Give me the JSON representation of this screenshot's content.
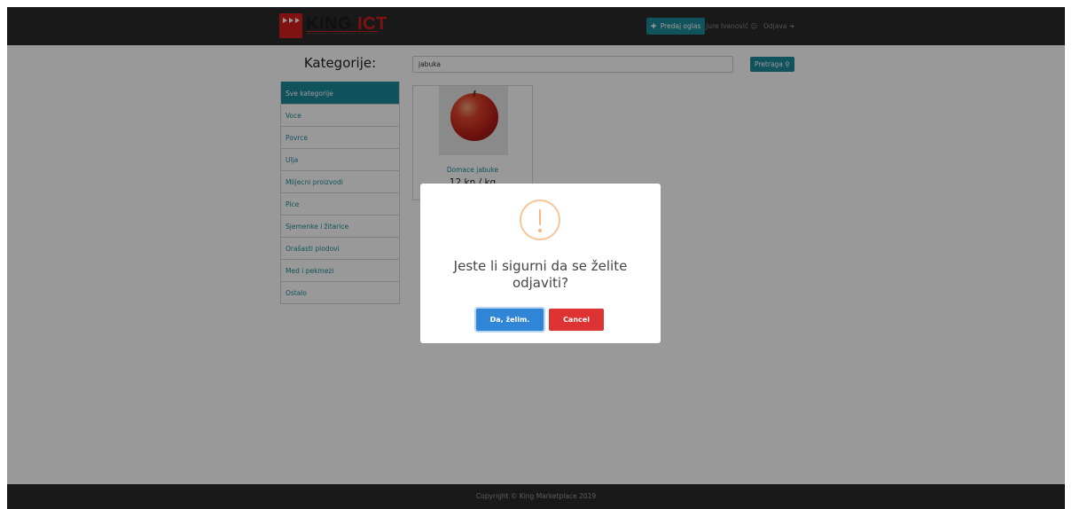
{
  "navbar": {
    "logo": {
      "brand_primary": "KING",
      "brand_secondary": "ICT",
      "tagline": "INFORMATION & COMMUNICATION TECHNOLOGY"
    },
    "post_ad_label": "Predaj oglas",
    "post_ad_icon": "plus-icon",
    "user_name": "Jure Ivanović",
    "user_icon": "user-icon",
    "logout_label": "Odjava",
    "logout_icon": "sign-out-icon"
  },
  "sidebar": {
    "title": "Kategorije:",
    "items": [
      {
        "label": "Sve kategorije",
        "active": true
      },
      {
        "label": "Voce",
        "active": false
      },
      {
        "label": "Povrce",
        "active": false
      },
      {
        "label": "Ulja",
        "active": false
      },
      {
        "label": "Mlijecni proizvodi",
        "active": false
      },
      {
        "label": "Pice",
        "active": false
      },
      {
        "label": "Sjemenke i žitarice",
        "active": false
      },
      {
        "label": "Orašasti plodovi",
        "active": false
      },
      {
        "label": "Med i pekmezi",
        "active": false
      },
      {
        "label": "Ostalo",
        "active": false
      }
    ]
  },
  "search": {
    "value": "jabuka",
    "button_label": "Pretraga",
    "button_icon": "search-icon"
  },
  "products": [
    {
      "name": "Domace jabuke",
      "price": "12 kn / kg",
      "image": "apple-image"
    }
  ],
  "footer": {
    "copyright": "Copyright © King Marketplace 2019"
  },
  "modal": {
    "icon": "warning-icon",
    "title": "Jeste li sigurni da se želite odjaviti?",
    "confirm_label": "Da, želim.",
    "cancel_label": "Cancel"
  },
  "colors": {
    "navbar_bg": "#2b2b2b",
    "accent_teal": "#1d8a9a",
    "brand_red": "#d81e1e",
    "confirm_blue": "#3085d6",
    "cancel_red": "#dd3333",
    "warning_orange": "#f5b77c"
  }
}
